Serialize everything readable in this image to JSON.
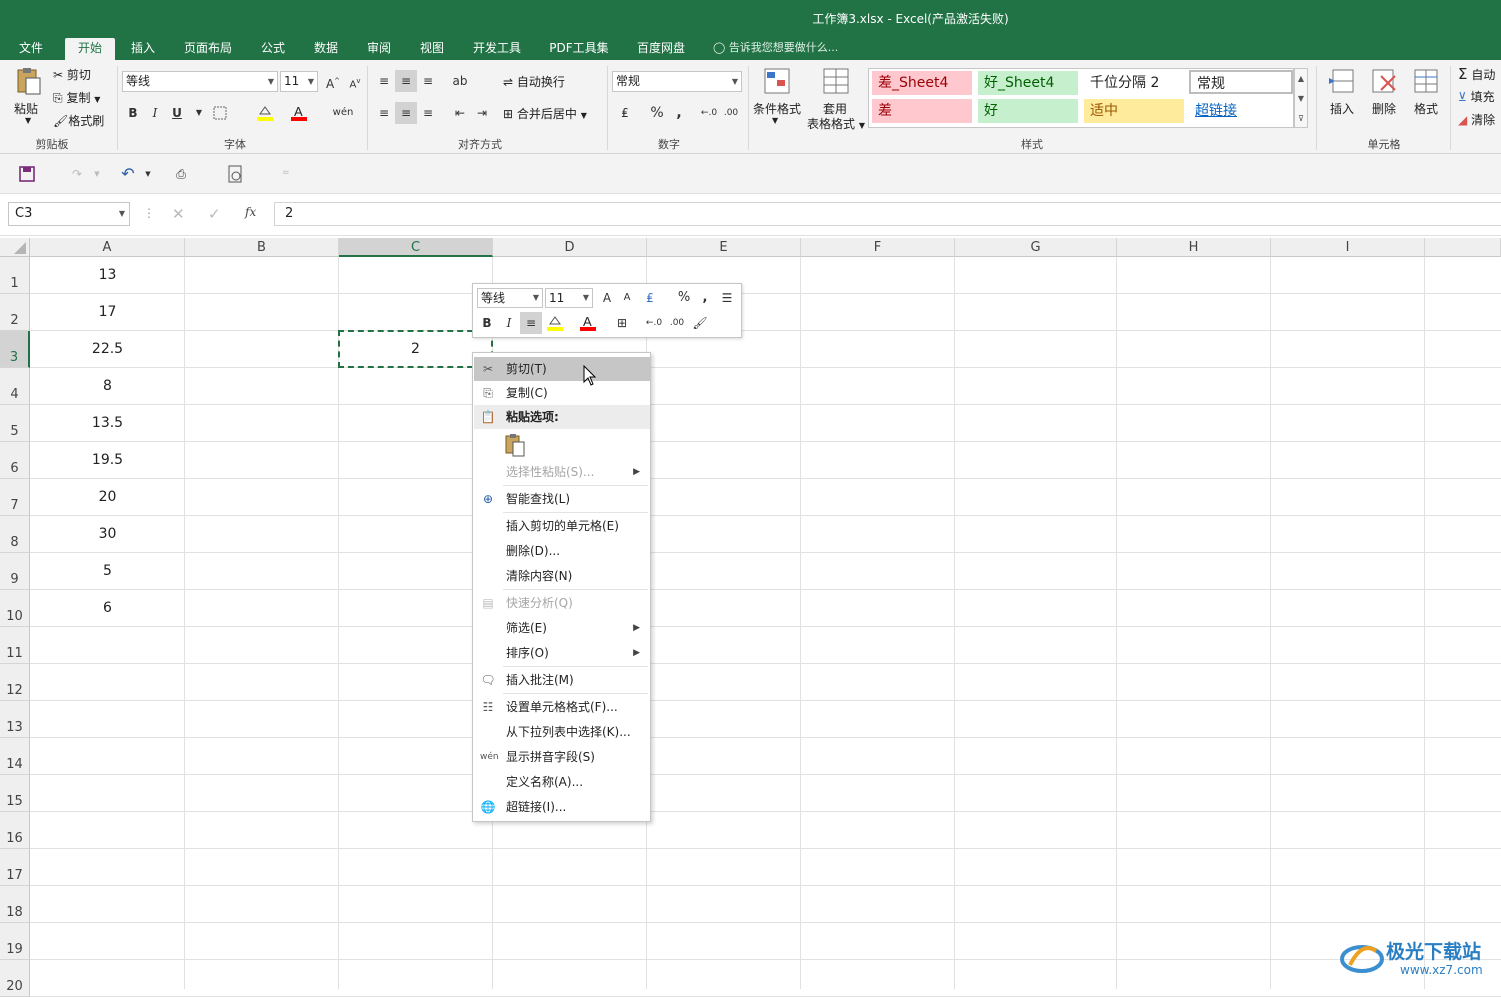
{
  "window": {
    "title": "工作簿3.xlsx - Excel(产品激活失败)"
  },
  "tabs": [
    "文件",
    "开始",
    "插入",
    "页面布局",
    "公式",
    "数据",
    "审阅",
    "视图",
    "开发工具",
    "PDF工具集",
    "百度网盘"
  ],
  "tell_me": "告诉我您想要做什么...",
  "ribbon": {
    "clipboard": {
      "paste": "粘贴",
      "cut": "剪切",
      "copy": "复制",
      "format_painter": "格式刷",
      "label": "剪贴板"
    },
    "font": {
      "name": "等线",
      "size": "11",
      "label": "字体",
      "bold": "B",
      "italic": "I",
      "underline": "U"
    },
    "alignment": {
      "wrap": "自动换行",
      "merge": "合并后居中",
      "label": "对齐方式"
    },
    "number": {
      "format": "常规",
      "label": "数字",
      "percent": "%",
      "comma": ","
    },
    "styles": {
      "conditional": "条件格式",
      "table_format_1": "套用",
      "table_format_2": "表格格式",
      "cells": [
        "差_Sheet4",
        "好_Sheet4",
        "千位分隔 2",
        "常规",
        "差",
        "好",
        "适中",
        "超链接"
      ],
      "label": "样式"
    },
    "cells": {
      "insert": "插入",
      "delete": "删除",
      "format": "格式",
      "label": "单元格"
    },
    "editing": {
      "autosum": "自动",
      "fill": "填充",
      "clear": "清除"
    }
  },
  "formula_bar": {
    "name_box": "C3",
    "fx": "fx",
    "value": "2"
  },
  "columns": [
    "A",
    "B",
    "C",
    "D",
    "E",
    "F",
    "G",
    "H",
    "I"
  ],
  "rows": [
    "1",
    "2",
    "3",
    "4",
    "5",
    "6",
    "7",
    "8",
    "9",
    "10",
    "11",
    "12",
    "13",
    "14",
    "15",
    "16",
    "17",
    "18",
    "19",
    "20"
  ],
  "column_a_values": [
    "13",
    "17",
    "22.5",
    "8",
    "13.5",
    "19.5",
    "20",
    "30",
    "5",
    "6"
  ],
  "active_cell_value": "2",
  "mini_toolbar": {
    "font": "等线",
    "size": "11",
    "percent": "%",
    "comma": ","
  },
  "context_menu": [
    {
      "label": "剪切(T)",
      "icon": "scissors-icon"
    },
    {
      "label": "复制(C)",
      "icon": "copy-icon"
    },
    {
      "label": "粘贴选项:",
      "icon": "paste-icon"
    },
    {
      "label": "选择性粘贴(S)..."
    },
    {
      "label": "智能查找(L)",
      "icon": "smart-lookup-icon"
    },
    {
      "label": "插入剪切的单元格(E)"
    },
    {
      "label": "删除(D)..."
    },
    {
      "label": "清除内容(N)"
    },
    {
      "label": "快速分析(Q)",
      "icon": "quick-analysis-icon"
    },
    {
      "label": "筛选(E)"
    },
    {
      "label": "排序(O)"
    },
    {
      "label": "插入批注(M)",
      "icon": "comment-icon"
    },
    {
      "label": "设置单元格格式(F)...",
      "icon": "format-cells-icon"
    },
    {
      "label": "从下拉列表中选择(K)..."
    },
    {
      "label": "显示拼音字段(S)",
      "icon": "phonetic-icon"
    },
    {
      "label": "定义名称(A)..."
    },
    {
      "label": "超链接(I)...",
      "icon": "hyperlink-icon"
    }
  ],
  "watermark": {
    "text": "极光下载站",
    "url": "www.xz7.com"
  },
  "colors": {
    "excel_green": "#217346",
    "bad_bg": "#ffc7ce",
    "good_bg": "#c6efce",
    "neutral_bg": "#ffeb9c"
  }
}
